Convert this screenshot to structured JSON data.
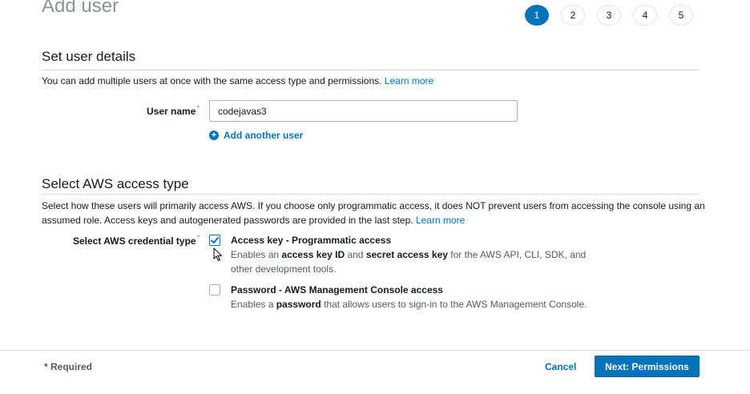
{
  "page": {
    "title": "Add user"
  },
  "steps": [
    "1",
    "2",
    "3",
    "4",
    "5"
  ],
  "active_step": "1",
  "user_details": {
    "heading": "Set user details",
    "description": "You can add multiple users at once with the same access type and permissions.",
    "learn_more": "Learn more",
    "user_name_label": "User name",
    "required_marker": "*",
    "user_name_value": "codejavas3",
    "add_another_user": "Add another user"
  },
  "access_type": {
    "heading": "Select AWS access type",
    "description": "Select how these users will primarily access AWS. If you choose only programmatic access, it does NOT prevent users from accessing the console using an assumed role. Access keys and autogenerated passwords are provided in the last step.",
    "learn_more": "Learn more",
    "credential_label": "Select AWS credential type",
    "required_marker": "*",
    "options": [
      {
        "title": "Access key - Programmatic access",
        "checked": true,
        "desc_parts": [
          "Enables an ",
          "access key ID",
          " and ",
          "secret access key",
          " for the AWS API, CLI, SDK, and other development tools."
        ]
      },
      {
        "title": "Password - AWS Management Console access",
        "checked": false,
        "desc_parts": [
          "Enables a ",
          "password",
          " that allows users to sign-in to the AWS Management Console."
        ]
      }
    ]
  },
  "footer": {
    "required_note": "* Required",
    "cancel": "Cancel",
    "next": "Next: Permissions"
  },
  "colors": {
    "accent": "#0073bb",
    "text": "#16191f",
    "muted": "#879596",
    "border": "#d5dbdb"
  }
}
